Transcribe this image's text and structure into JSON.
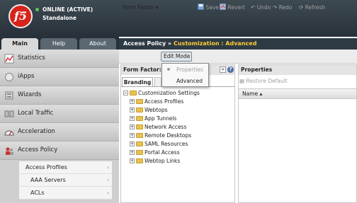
{
  "header": {
    "logo_text": "f5",
    "status_line1": "ONLINE (ACTIVE)",
    "status_line2": "Standalone"
  },
  "tabs": [
    {
      "label": "Main"
    },
    {
      "label": "Help"
    },
    {
      "label": "About"
    }
  ],
  "sidebar": {
    "items": [
      {
        "label": "Statistics",
        "icon": "statistics-icon"
      },
      {
        "label": "iApps",
        "icon": "iapps-icon"
      },
      {
        "label": "Wizards",
        "icon": "wizards-icon"
      },
      {
        "label": "Local Traffic",
        "icon": "local-traffic-icon"
      },
      {
        "label": "Acceleration",
        "icon": "acceleration-icon"
      },
      {
        "label": "Access Policy",
        "icon": "access-policy-icon"
      }
    ],
    "subitems": [
      {
        "label": "Access Profiles"
      },
      {
        "label": "AAA Servers"
      },
      {
        "label": "ACLs"
      }
    ],
    "arrow_glyph": "›"
  },
  "titlebar": {
    "section": "Access Policy",
    "separator": "»",
    "crumb": "Customization : Advanced"
  },
  "toolbar": {
    "form_factor": "Form Factor",
    "edit_mode": "Edit Mode",
    "save": "Save",
    "revert": "Revert",
    "undo": "Undo",
    "redo": "Redo",
    "refresh": "Refresh"
  },
  "dropdown": {
    "items": [
      {
        "label": "Properties"
      },
      {
        "label": "Advanced"
      }
    ]
  },
  "left_panel": {
    "header": "Form Factor: Fu",
    "tab_branding": "Branding",
    "tree_root": "Customization Settings",
    "tree_items": [
      {
        "label": "Access Profiles"
      },
      {
        "label": "Webtops"
      },
      {
        "label": "App Tunnels"
      },
      {
        "label": "Network Access"
      },
      {
        "label": "Remote Desktops"
      },
      {
        "label": "SAML Resources"
      },
      {
        "label": "Portal Access"
      },
      {
        "label": "Webtop Links"
      }
    ]
  },
  "right_panel": {
    "header": "Properties",
    "restore_default": "Restore Default",
    "column_name": "Name ▴"
  }
}
